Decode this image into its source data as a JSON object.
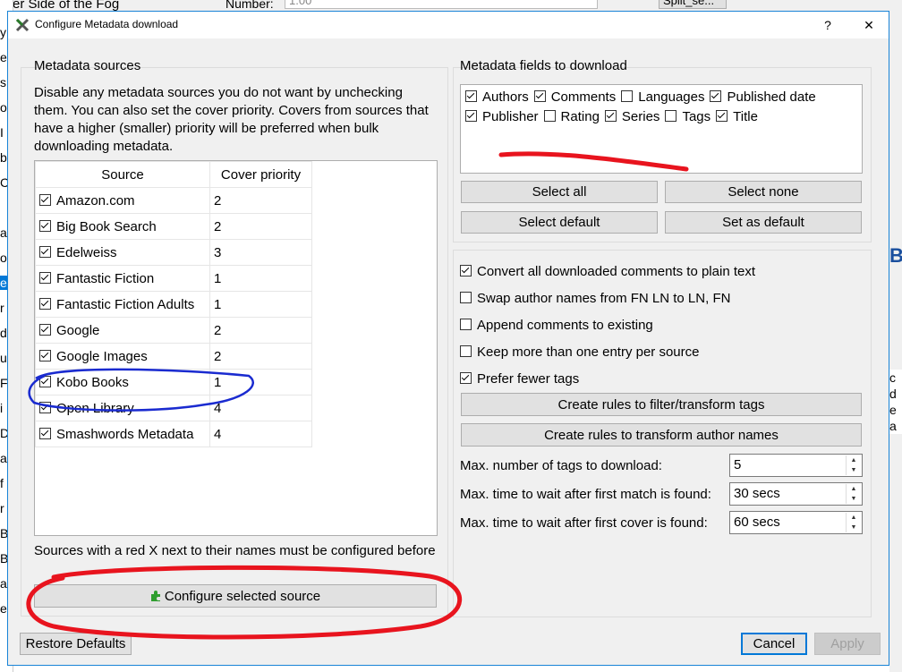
{
  "background": {
    "top_text": "er Side of the Fog",
    "number_label": "Number:",
    "number_value": "1.00",
    "split_button": "Split_se..."
  },
  "dialog": {
    "title": "Configure Metadata download",
    "help_button": "?",
    "close_button": "✕"
  },
  "sources": {
    "group_title": "Metadata sources",
    "description": "Disable any metadata sources you do not want by unchecking them. You can also set the cover priority. Covers from sources that have a higher (smaller) priority will be preferred when bulk downloading metadata.",
    "columns": [
      "Source",
      "Cover priority"
    ],
    "rows": [
      {
        "name": "Amazon.com",
        "priority": "2",
        "checked": true
      },
      {
        "name": "Big Book Search",
        "priority": "2",
        "checked": true
      },
      {
        "name": "Edelweiss",
        "priority": "3",
        "checked": true
      },
      {
        "name": "Fantastic Fiction",
        "priority": "1",
        "checked": true
      },
      {
        "name": "Fantastic Fiction Adults",
        "priority": "1",
        "checked": true
      },
      {
        "name": "Google",
        "priority": "2",
        "checked": true
      },
      {
        "name": "Google Images",
        "priority": "2",
        "checked": true
      },
      {
        "name": "Kobo Books",
        "priority": "1",
        "checked": true
      },
      {
        "name": "Open Library",
        "priority": "4",
        "checked": true
      },
      {
        "name": "Smashwords Metadata",
        "priority": "4",
        "checked": true
      }
    ],
    "note": "Sources with a red X next to their names must be configured before they will be used.",
    "configure_button": "Configure selected source"
  },
  "fields": {
    "group_title": "Metadata fields to download",
    "items": [
      {
        "label": "Authors",
        "checked": true
      },
      {
        "label": "Comments",
        "checked": true
      },
      {
        "label": "Languages",
        "checked": false
      },
      {
        "label": "Published date",
        "checked": true
      },
      {
        "label": "Publisher",
        "checked": true
      },
      {
        "label": "Rating",
        "checked": false
      },
      {
        "label": "Series",
        "checked": true
      },
      {
        "label": "Tags",
        "checked": false
      },
      {
        "label": "Title",
        "checked": true
      }
    ],
    "select_all": "Select all",
    "select_none": "Select none",
    "select_default": "Select default",
    "set_as_default": "Set as default"
  },
  "options": {
    "checkboxes": [
      {
        "label": "Convert all downloaded comments to plain text",
        "checked": true
      },
      {
        "label": "Swap author names from FN LN to LN, FN",
        "checked": false
      },
      {
        "label": "Append comments to existing",
        "checked": false
      },
      {
        "label": "Keep more than one entry per source",
        "checked": false
      },
      {
        "label": "Prefer fewer tags",
        "checked": true
      }
    ],
    "filter_tags_button": "Create rules to filter/transform tags",
    "transform_authors_button": "Create rules to transform author names",
    "max_tags_label": "Max. number of tags to download:",
    "max_tags_value": "5",
    "wait_match_label": "Max. time to wait after first match is found:",
    "wait_match_value": "30 secs",
    "wait_cover_label": "Max. time to wait after first cover is found:",
    "wait_cover_value": "60 secs"
  },
  "footer": {
    "restore_defaults": "Restore Defaults",
    "cancel": "Cancel",
    "apply": "Apply"
  },
  "colors": {
    "accent": "#0078d7",
    "annotation_red": "#e8141e",
    "annotation_blue": "#1a2bd0"
  }
}
